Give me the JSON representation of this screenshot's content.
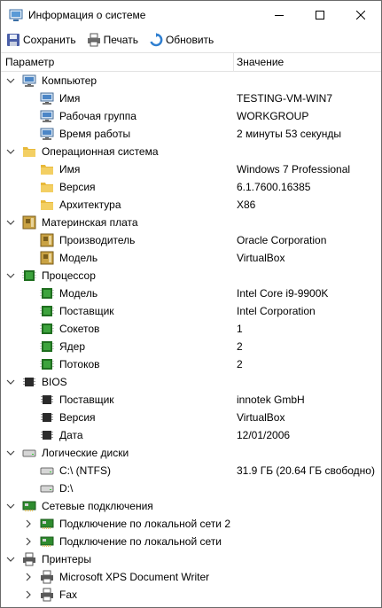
{
  "window": {
    "title": "Информация о системе",
    "icon": "system-info-icon"
  },
  "toolbar": {
    "save_label": "Сохранить",
    "print_label": "Печать",
    "refresh_label": "Обновить"
  },
  "header": {
    "param": "Параметр",
    "value": "Значение"
  },
  "colors": {
    "folder": "#f0c44a",
    "board": "#c9a243",
    "chip": "#2e8b2e",
    "monitor": "#3a6ea5"
  },
  "rows": [
    {
      "label": "Компьютер",
      "value": "",
      "level": 0,
      "arrow": "expanded",
      "icon": "computer-icon"
    },
    {
      "label": "Имя",
      "value": "TESTING-VM-WIN7",
      "level": 1,
      "arrow": "",
      "icon": "computer-icon"
    },
    {
      "label": "Рабочая группа",
      "value": "WORKGROUP",
      "level": 1,
      "arrow": "",
      "icon": "computer-icon"
    },
    {
      "label": "Время работы",
      "value": "2 минуты 53 секунды",
      "level": 1,
      "arrow": "",
      "icon": "computer-icon"
    },
    {
      "label": "Операционная система",
      "value": "",
      "level": 0,
      "arrow": "expanded",
      "icon": "folder-icon"
    },
    {
      "label": "Имя",
      "value": "Windows 7 Professional",
      "level": 1,
      "arrow": "",
      "icon": "folder-icon"
    },
    {
      "label": "Версия",
      "value": "6.1.7600.16385",
      "level": 1,
      "arrow": "",
      "icon": "folder-icon"
    },
    {
      "label": "Архитектура",
      "value": "X86",
      "level": 1,
      "arrow": "",
      "icon": "folder-icon"
    },
    {
      "label": "Материнская плата",
      "value": "",
      "level": 0,
      "arrow": "expanded",
      "icon": "motherboard-icon"
    },
    {
      "label": "Производитель",
      "value": "Oracle Corporation",
      "level": 1,
      "arrow": "",
      "icon": "motherboard-icon"
    },
    {
      "label": "Модель",
      "value": "VirtualBox",
      "level": 1,
      "arrow": "",
      "icon": "motherboard-icon"
    },
    {
      "label": "Процессор",
      "value": "",
      "level": 0,
      "arrow": "expanded",
      "icon": "cpu-icon"
    },
    {
      "label": "Модель",
      "value": "Intel Core i9-9900K",
      "level": 1,
      "arrow": "",
      "icon": "cpu-icon"
    },
    {
      "label": "Поставщик",
      "value": "Intel Corporation",
      "level": 1,
      "arrow": "",
      "icon": "cpu-icon"
    },
    {
      "label": "Сокетов",
      "value": "1",
      "level": 1,
      "arrow": "",
      "icon": "cpu-icon"
    },
    {
      "label": "Ядер",
      "value": "2",
      "level": 1,
      "arrow": "",
      "icon": "cpu-icon"
    },
    {
      "label": "Потоков",
      "value": "2",
      "level": 1,
      "arrow": "",
      "icon": "cpu-icon"
    },
    {
      "label": "BIOS",
      "value": "",
      "level": 0,
      "arrow": "expanded",
      "icon": "bios-chip-icon"
    },
    {
      "label": "Поставщик",
      "value": "innotek GmbH",
      "level": 1,
      "arrow": "",
      "icon": "bios-chip-icon"
    },
    {
      "label": "Версия",
      "value": "VirtualBox",
      "level": 1,
      "arrow": "",
      "icon": "bios-chip-icon"
    },
    {
      "label": "Дата",
      "value": "12/01/2006",
      "level": 1,
      "arrow": "",
      "icon": "bios-chip-icon"
    },
    {
      "label": "Логические диски",
      "value": "",
      "level": 0,
      "arrow": "expanded",
      "icon": "disk-icon"
    },
    {
      "label": "C:\\ (NTFS)",
      "value": "31.9 ГБ (20.64 ГБ свободно)",
      "level": 1,
      "arrow": "",
      "icon": "disk-icon"
    },
    {
      "label": "D:\\",
      "value": "",
      "level": 1,
      "arrow": "",
      "icon": "disk-icon"
    },
    {
      "label": "Сетевые подключения",
      "value": "",
      "level": 0,
      "arrow": "expanded",
      "icon": "network-card-icon"
    },
    {
      "label": "Подключение по локальной сети 2",
      "value": "",
      "level": 1,
      "arrow": "collapsed",
      "icon": "network-card-icon"
    },
    {
      "label": "Подключение по локальной сети",
      "value": "",
      "level": 1,
      "arrow": "collapsed",
      "icon": "network-card-icon"
    },
    {
      "label": "Принтеры",
      "value": "",
      "level": 0,
      "arrow": "expanded",
      "icon": "printer-icon"
    },
    {
      "label": "Microsoft XPS Document Writer",
      "value": "",
      "level": 1,
      "arrow": "collapsed",
      "icon": "printer-icon"
    },
    {
      "label": "Fax",
      "value": "",
      "level": 1,
      "arrow": "collapsed",
      "icon": "printer-icon"
    }
  ]
}
